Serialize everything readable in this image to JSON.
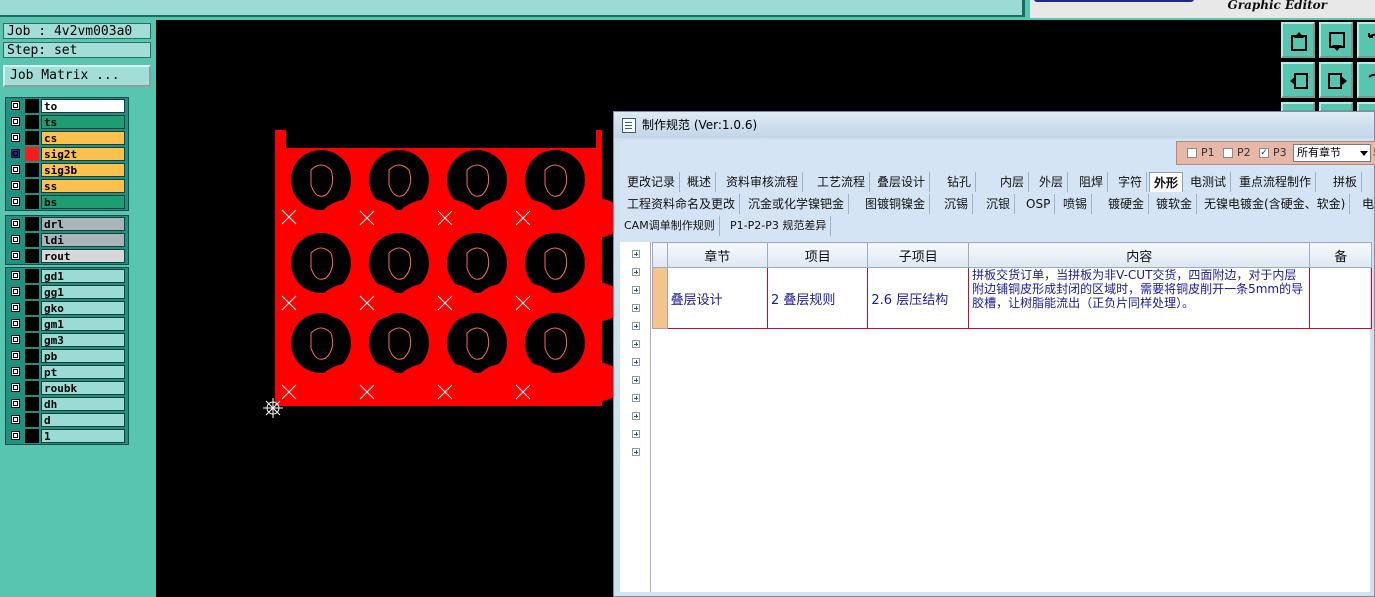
{
  "app": {
    "subtitle": "Graphic Editor"
  },
  "job": {
    "job_label": "Job : 4v2vm003a0",
    "step_label": "Step: set",
    "matrix_button": "Job Matrix ..."
  },
  "layer_groups": [
    [
      {
        "name": "to",
        "color": "#ffffff",
        "checked": false
      },
      {
        "name": "ts",
        "color": "#1e9c72",
        "checked": false
      },
      {
        "name": "cs",
        "color": "#ffc04c",
        "checked": false
      },
      {
        "name": "sig2t",
        "color": "#ffc04c",
        "checked": true,
        "swatch": "#ff1a1a"
      },
      {
        "name": "sig3b",
        "color": "#ffc04c",
        "checked": false
      },
      {
        "name": "ss",
        "color": "#ffc04c",
        "checked": false
      },
      {
        "name": "bs",
        "color": "#1e9c72",
        "checked": false
      }
    ],
    [
      {
        "name": "drl",
        "color": "#a8b4b8",
        "checked": false
      },
      {
        "name": "ldi",
        "color": "#a8b4b8",
        "checked": false
      },
      {
        "name": "rout",
        "color": "#d8d8d8",
        "checked": false
      }
    ],
    [
      {
        "name": "gd1",
        "color": "#9adbd6",
        "checked": false
      },
      {
        "name": "gg1",
        "color": "#9adbd6",
        "checked": false
      },
      {
        "name": "gko",
        "color": "#9adbd6",
        "checked": false
      },
      {
        "name": "gm1",
        "color": "#9adbd6",
        "checked": false
      },
      {
        "name": "gm3",
        "color": "#9adbd6",
        "checked": false
      },
      {
        "name": "pb",
        "color": "#9adbd6",
        "checked": false
      },
      {
        "name": "pt",
        "color": "#9adbd6",
        "checked": false
      },
      {
        "name": "roubk",
        "color": "#9adbd6",
        "checked": false
      },
      {
        "name": "dh",
        "color": "#9adbd6",
        "checked": false
      },
      {
        "name": "d",
        "color": "#9adbd6",
        "checked": false
      },
      {
        "name": "1",
        "color": "#9adbd6",
        "checked": false
      }
    ]
  ],
  "toolbar_icons": [
    "upload-icon",
    "download-icon",
    "undo-icon",
    "move-in-icon",
    "move-out-icon",
    "rotate-icon"
  ],
  "dialog": {
    "title": "制作规范 (Ver:1.0.6)",
    "filters": {
      "p1": {
        "label": "P1",
        "checked": false
      },
      "p2": {
        "label": "P2",
        "checked": false
      },
      "p3": {
        "label": "P3",
        "checked": true
      },
      "chapter_select": "所有章节",
      "cut_text": "导"
    },
    "tabs_row1": [
      "更改记录",
      "概述",
      "资料审核流程",
      "工艺流程",
      "叠层设计",
      "钻孔",
      "内层",
      "外层",
      "阻焊",
      "字符",
      "外形",
      "电测试",
      "重点流程制作",
      "拼板"
    ],
    "active_tab": "外形",
    "tabs_row2": [
      "工程资料命名及更改",
      "沉金或化学镍钯金",
      "图镀铜镍金",
      "沉锡",
      "沉银",
      "OSP",
      "喷锡",
      "镀硬金",
      "镀软金",
      "无镍电镀金(含硬金、软金)",
      "电"
    ],
    "tabs_row3": [
      "CAM调单制作规则",
      "P1-P2-P3 规范差异"
    ],
    "table": {
      "headers": [
        "章节",
        "项目",
        "子项目",
        "内容",
        "备"
      ],
      "rows": [
        [
          "叠层设计",
          "2 叠层规则",
          "2.6 层压结构",
          "拼板交货订单，当拼板为非V-CUT交货，四面附边，对于内层附边铺铜皮形成封闭的区域时，需要将铜皮削开一条5mm的导胶槽，让树脂能流出（正负片同样处理）。",
          ""
        ]
      ]
    },
    "tree_nodes": 12
  },
  "colors": {
    "panel": "#58c5b0",
    "pcb_red": "#ff0000"
  }
}
